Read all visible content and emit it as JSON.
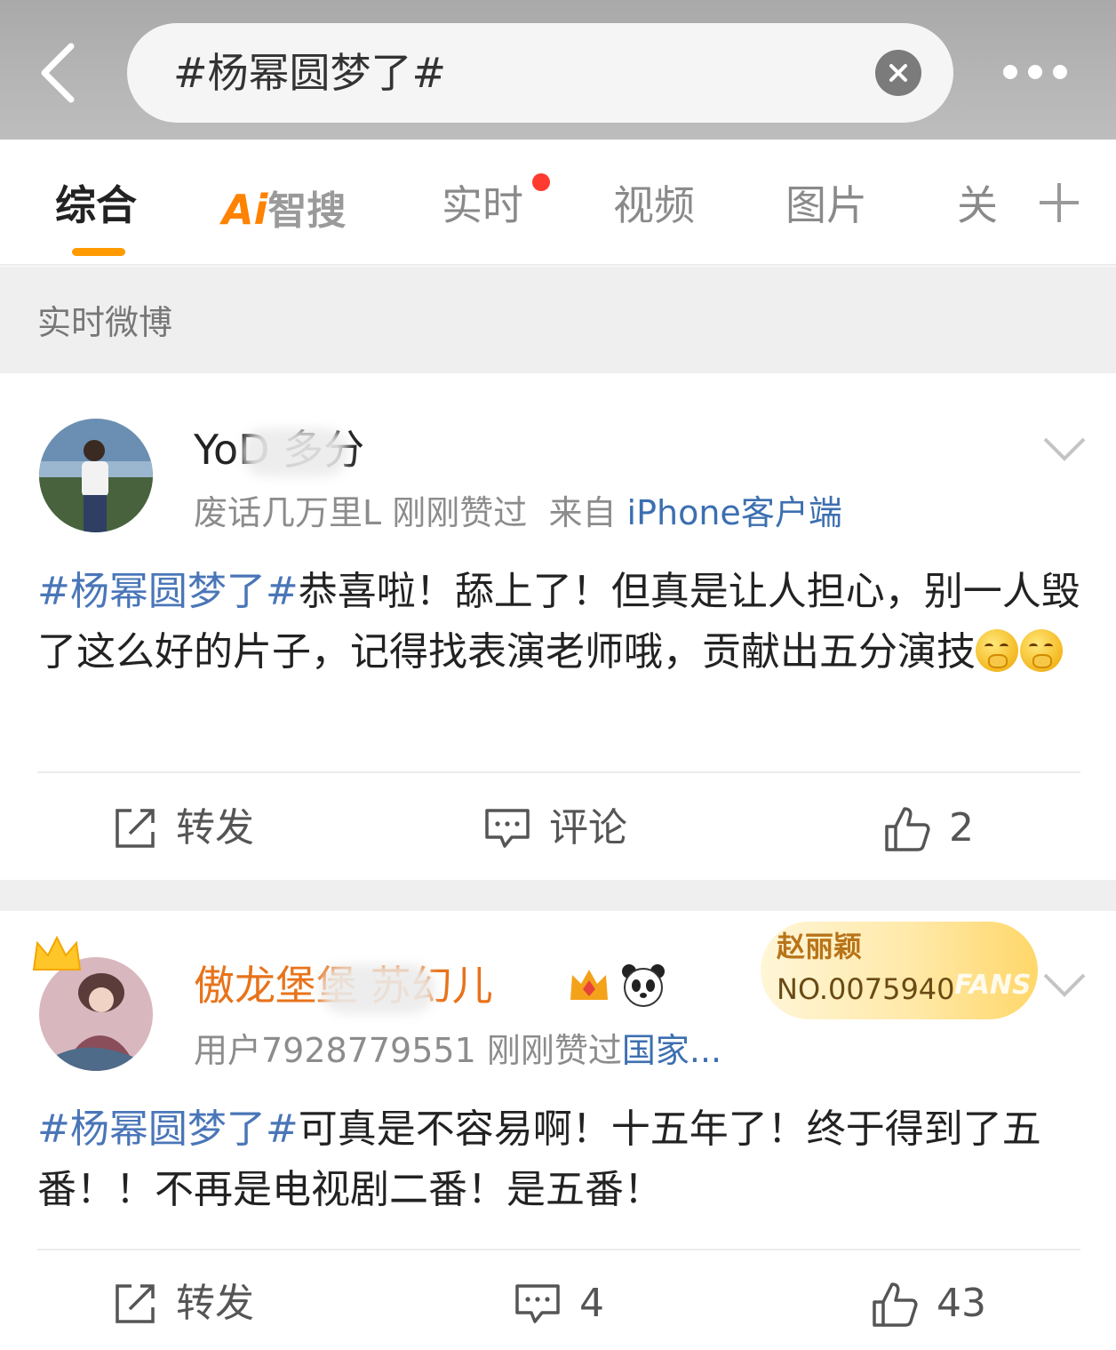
{
  "header": {
    "search_query": "#杨幂圆梦了#",
    "back_icon": "chevron-left-icon",
    "clear_icon": "close-icon",
    "more_icon": "more-dots-icon"
  },
  "tabs": [
    {
      "label": "综合",
      "active": true
    },
    {
      "label": "Ai",
      "sub": "智搜"
    },
    {
      "label": "实时",
      "has_dot": true
    },
    {
      "label": "视频"
    },
    {
      "label": "图片"
    },
    {
      "label": "关"
    }
  ],
  "section_label": "实时微博",
  "posts": [
    {
      "username": "YoD  多分",
      "meta_text": "废话几万里L 刚刚赞过",
      "meta_from": "来自",
      "meta_source": "iPhone客户端",
      "topic": "#杨幂圆梦了#",
      "content": "恭喜啦！舔上了！但真是让人担心，别一人毁了这么好的片子，记得找表演老师哦，贡献出五分演技",
      "repost_label": "转发",
      "comment_label": "评论",
      "like_count": "2"
    },
    {
      "username": "傲龙堡堡   苏幻儿",
      "meta_text": "用户7928779551 刚刚赞过",
      "meta_source": "国家...",
      "fans_name": "赵丽颖",
      "fans_no": "NO.0075940",
      "fans_tag": "FANS",
      "topic": "#杨幂圆梦了#",
      "content": "可真是不容易啊！十五年了！终于得到了五番！！不再是电视剧二番！是五番！",
      "repost_label": "转发",
      "comment_count": "4",
      "like_count": "43"
    }
  ],
  "colors": {
    "accent": "#ff9a00",
    "topic_link": "#4a76b8",
    "username_orange": "#e8731a"
  }
}
